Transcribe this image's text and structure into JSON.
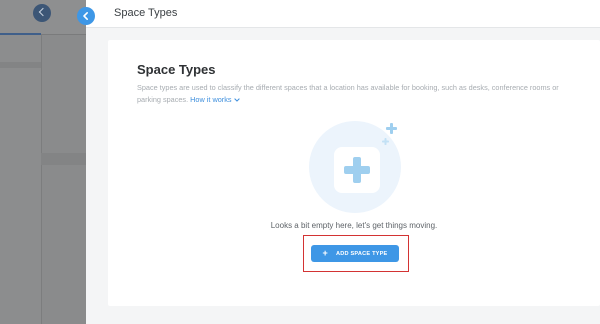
{
  "panel": {
    "title": "Space Types"
  },
  "card": {
    "heading": "Space Types",
    "description": "Space types are used to classify the different spaces that a location has available for booking, such as desks, conference rooms or parking spaces.",
    "how_it_works": "How it works",
    "empty_message": "Looks a bit empty here, let's get things moving.",
    "add_button_label": "ADD SPACE TYPE"
  },
  "icons": {
    "back": "chevron-left-icon",
    "close": "chevron-left-icon",
    "link_chevron": "chevron-down-icon",
    "illustration": "plus-icon",
    "button": "plus-icon"
  },
  "colors": {
    "accent": "#3e97e6",
    "highlight": "#d33333",
    "link": "#3e8fdd"
  }
}
